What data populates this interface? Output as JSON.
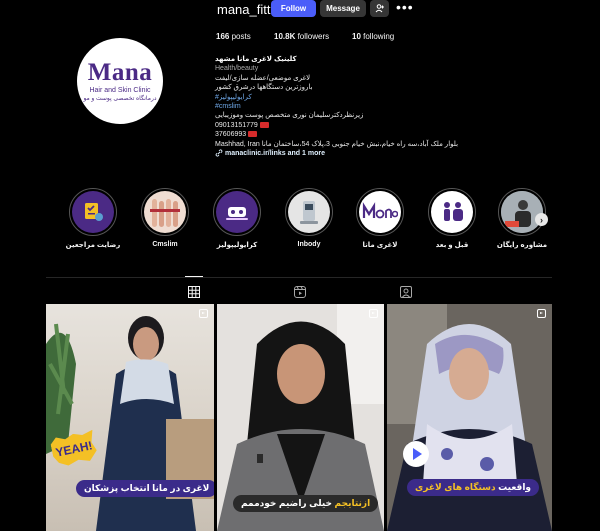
{
  "profile": {
    "username": "mana_fitt",
    "follow_label": "Follow",
    "message_label": "Message",
    "posts_count": "166",
    "posts_label": " posts",
    "followers_count": "10.8K",
    "followers_label": " followers",
    "following_count": "10",
    "following_label": " following",
    "avatar_brand": "Mana",
    "avatar_line1": "Hair and Skin Clinic",
    "avatar_line2": "درمانگاه تخصصی پوست و مو"
  },
  "bio": {
    "name": "کلینیک لاغری مانا مشهد",
    "category": "Health/beauty",
    "line1": "لاغری موضعی/عضله سازی/لیفت",
    "line2": "باروزترین دستگاهها درشرق کشور",
    "tag1": "#کرایولیپولیز",
    "tag2": "#cmslim",
    "line3": "زیرنظردکترسلیمان نوری متخصص پوست وموزیبایی",
    "phone1": "09013151779",
    "phone2": "37606993",
    "address": "Mashhad, Iran بلوار ملک آباد،سه راه خیام،نبش خیام جنوبی 3،پلاک 54،ساختمان مانا",
    "link": "manaclinic.ir/links and 1 more"
  },
  "highlights": [
    {
      "label": "رضایت مراجعین",
      "icon": "checklist-icon"
    },
    {
      "label": "Cmslim",
      "icon": "legs-photo-icon"
    },
    {
      "label": "کرایولیپولیز",
      "icon": "device-icon"
    },
    {
      "label": "Inbody",
      "icon": "inbody-device-icon"
    },
    {
      "label": "لاغری مانا",
      "icon": "mana-logo-icon"
    },
    {
      "label": "قبل و بعد",
      "icon": "before-after-icon"
    },
    {
      "label": "مشاوره رایگان",
      "icon": "consultation-icon"
    }
  ],
  "posts": [
    {
      "caption": "لاغری در مانا انتخاب پزشکان",
      "badge": "YEAH!"
    },
    {
      "caption_highlight": "ازنتایجم",
      "caption_rest": " خیلی راضیم خودممم"
    },
    {
      "caption_rest": "واقعیت ",
      "caption_highlight": "دستگاه های لاغری"
    }
  ],
  "colors": {
    "accent": "#4a5df9",
    "brand_purple": "#3b2b8a",
    "highlight_yellow": "#f4c025"
  }
}
